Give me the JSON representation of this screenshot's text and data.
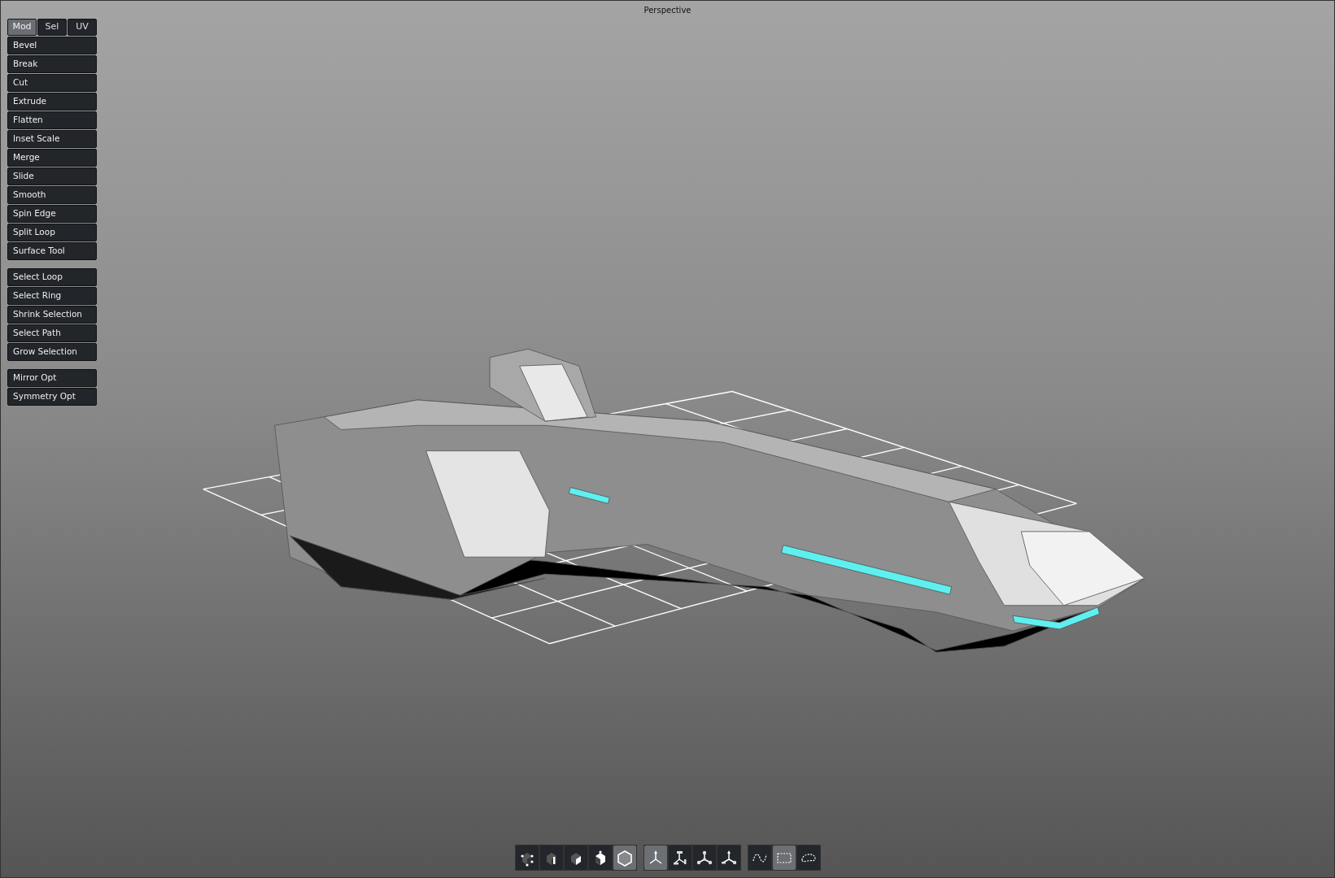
{
  "viewport": {
    "title": "Perspective"
  },
  "tabs": [
    {
      "label": "Mod",
      "selected": true
    },
    {
      "label": "Sel",
      "selected": false
    },
    {
      "label": "UV",
      "selected": false
    }
  ],
  "tool_groups": [
    [
      "Bevel",
      "Break",
      "Cut",
      "Extrude",
      "Flatten",
      "Inset Scale",
      "Merge",
      "Slide",
      "Smooth",
      "Spin Edge",
      "Split Loop",
      "Surface Tool"
    ],
    [
      "Select Loop",
      "Select Ring",
      "Shrink Selection",
      "Select Path",
      "Grow Selection"
    ],
    [
      "Mirror Opt",
      "Symmetry Opt"
    ]
  ],
  "toolbar_groups": [
    [
      {
        "kind": "vertex",
        "selected": false
      },
      {
        "kind": "edge",
        "selected": false
      },
      {
        "kind": "face",
        "selected": false
      },
      {
        "kind": "object",
        "selected": false
      },
      {
        "kind": "element",
        "selected": true
      }
    ],
    [
      {
        "kind": "move",
        "selected": true
      },
      {
        "kind": "rotate",
        "selected": false
      },
      {
        "kind": "scale",
        "selected": false
      },
      {
        "kind": "universal",
        "selected": false
      }
    ],
    [
      {
        "kind": "freehand",
        "selected": false
      },
      {
        "kind": "marquee",
        "selected": true
      },
      {
        "kind": "lasso",
        "selected": false
      }
    ]
  ]
}
